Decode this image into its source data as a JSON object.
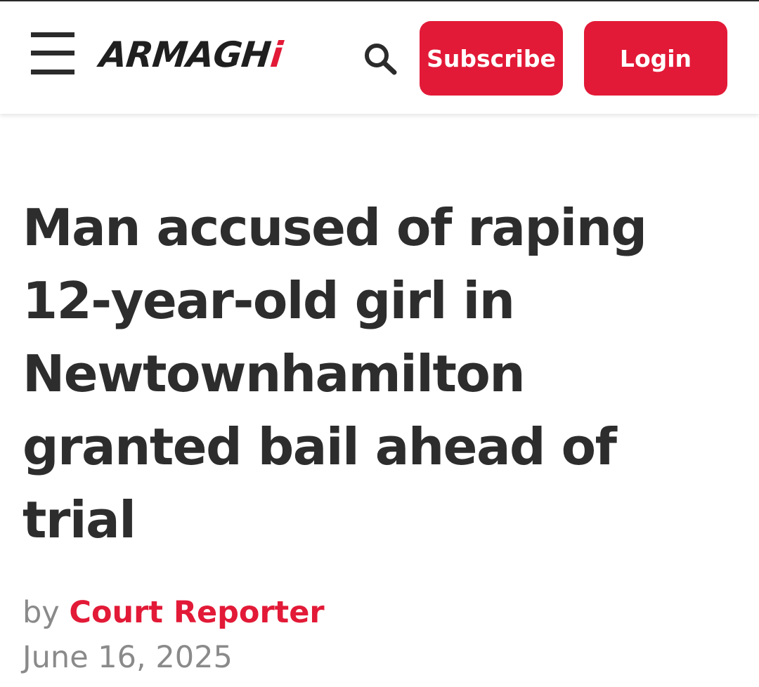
{
  "colors": {
    "accent": "#e21a37",
    "text_dark": "#2d2d2d",
    "text_muted": "#8a8a8a"
  },
  "header": {
    "logo": {
      "text": "ARMAGH",
      "suffix": "i"
    },
    "menu_icon": "hamburger-icon",
    "search_icon": "search-icon",
    "subscribe_label": "Subscribe",
    "login_label": "Login"
  },
  "article": {
    "headline": "Man accused of raping 12-year-old girl in Newtownhamilton granted bail ahead of trial",
    "byline_prefix": "by",
    "author": "Court Reporter",
    "date": "June 16, 2025"
  }
}
